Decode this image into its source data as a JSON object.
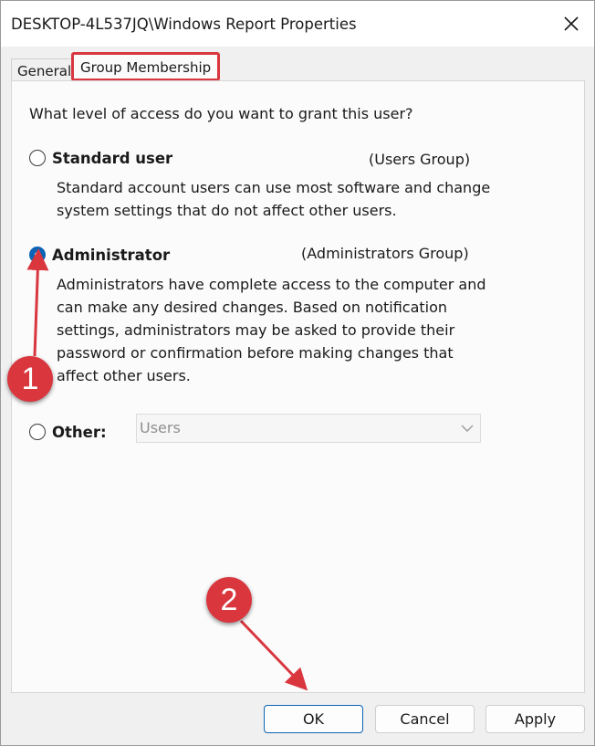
{
  "window": {
    "title": "DESKTOP-4L537JQ\\Windows Report Properties",
    "close_glyph": "✕"
  },
  "tabs": [
    {
      "label": "General",
      "selected": false
    },
    {
      "label": "Group Membership",
      "selected": true
    }
  ],
  "question": "What level of access do you want to grant this user?",
  "options": {
    "standard": {
      "label": "Standard user",
      "group": "(Users Group)",
      "checked": false,
      "description": [
        "Standard account users can use most software and change",
        "system settings that do not affect other users."
      ]
    },
    "administrator": {
      "label": "Administrator",
      "group": "(Administrators Group)",
      "checked": true,
      "description": [
        "Administrators have complete access to the computer and",
        "can make any desired changes. Based on notification",
        "settings, administrators may be asked to provide their",
        "password or confirmation before making changes that",
        "affect other users."
      ]
    },
    "other": {
      "label": "Other:",
      "checked": false,
      "select_value": "Users"
    }
  },
  "buttons": {
    "ok": "OK",
    "cancel": "Cancel",
    "apply": "Apply"
  },
  "annotations": {
    "step1": "1",
    "step2": "2",
    "color": "#d9363e"
  },
  "colors": {
    "accent": "#0b63b6",
    "highlight": "#d9363e"
  }
}
